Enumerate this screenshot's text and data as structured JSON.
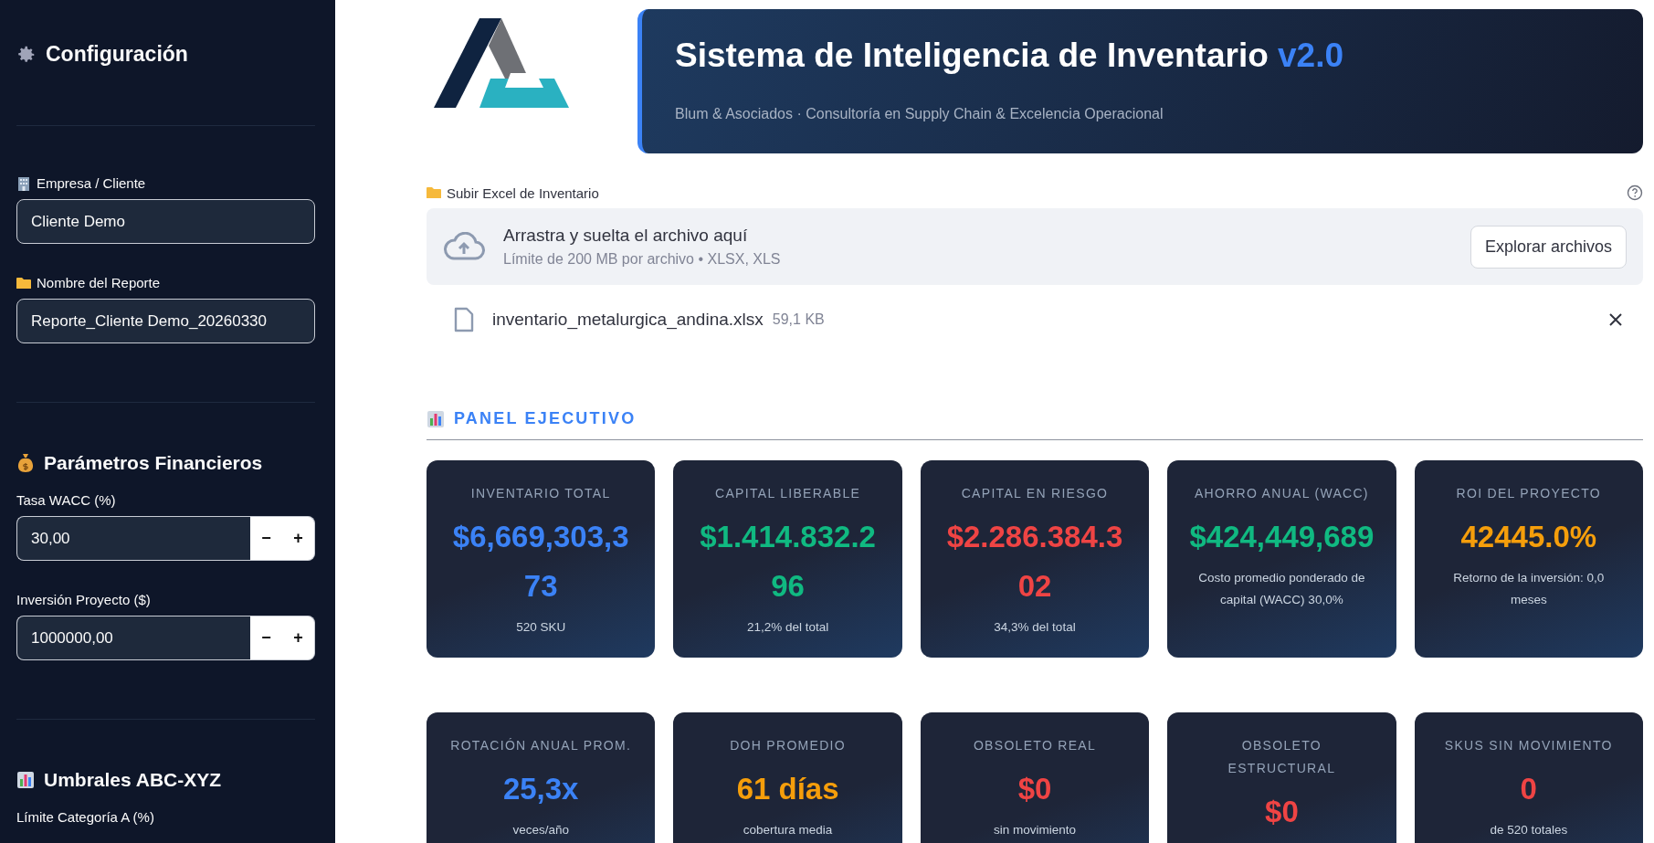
{
  "sidebar": {
    "title": "Configuración",
    "general_fields": [
      {
        "label": "Empresa / Cliente",
        "value": "Cliente Demo"
      },
      {
        "label": "Nombre del Reporte",
        "value": "Reporte_Cliente Demo_20260330"
      }
    ],
    "financial": {
      "title": "Parámetros Financieros",
      "fields": [
        {
          "label": "Tasa WACC (%)",
          "value": "30,00",
          "minus": "−",
          "plus": "+"
        },
        {
          "label": "Inversión Proyecto ($)",
          "value": "1000000,00",
          "minus": "−",
          "plus": "+"
        }
      ]
    },
    "thresholds": {
      "title": "Umbrales ABC-XYZ",
      "fields": [
        {
          "label": "Límite Categoría A (%)"
        }
      ]
    }
  },
  "header": {
    "title": "Sistema de Inteligencia de Inventario",
    "version": "v2.0",
    "subtitle": "Blum & Asociados · Consultoría en Supply Chain & Excelencia Operacional"
  },
  "uploader": {
    "label": "Subir Excel de Inventario",
    "drop_text": "Arrastra y suelta el archivo aquí",
    "hint": "Límite de 200 MB por archivo • XLSX, XLS",
    "button": "Explorar archivos",
    "file": {
      "name": "inventario_metalurgica_andina.xlsx",
      "size": "59,1 KB"
    }
  },
  "panel": {
    "title": "PANEL EJECUTIVO",
    "cards": [
      {
        "title": "INVENTARIO TOTAL",
        "value": "$6,669,303,373",
        "note": "520 SKU",
        "color": "#3b82f6"
      },
      {
        "title": "CAPITAL LIBERABLE",
        "value": "$1.414.832.296",
        "note": "21,2% del total",
        "color": "#10b981"
      },
      {
        "title": "CAPITAL EN RIESGO",
        "value": "$2.286.384.302",
        "note": "34,3% del total",
        "color": "#ef4444"
      },
      {
        "title": "AHORRO ANUAL (WACC)",
        "value": "$424,449,689",
        "note": "Costo promedio ponderado de capital (WACC) 30,0%",
        "color": "#10b981"
      },
      {
        "title": "ROI DEL PROYECTO",
        "value": "42445.0%",
        "note": "Retorno de la inversión: 0,0 meses",
        "color": "#f59e0b"
      },
      {
        "title": "ROTACIÓN ANUAL PROM.",
        "value": "25,3x",
        "note": "veces/año",
        "color": "#3b82f6"
      },
      {
        "title": "DOH PROMEDIO",
        "value": "61 días",
        "note": "cobertura media",
        "color": "#f59e0b"
      },
      {
        "title": "OBSOLETO REAL",
        "value": "$0",
        "note": "sin movimiento",
        "color": "#ef4444"
      },
      {
        "title": "OBSOLETO ESTRUCTURAL",
        "value": "$0",
        "color": "#ef4444"
      },
      {
        "title": "SKUS SIN MOVIMIENTO",
        "value": "0",
        "note": "de 520 totales",
        "color": "#ef4444"
      }
    ]
  }
}
